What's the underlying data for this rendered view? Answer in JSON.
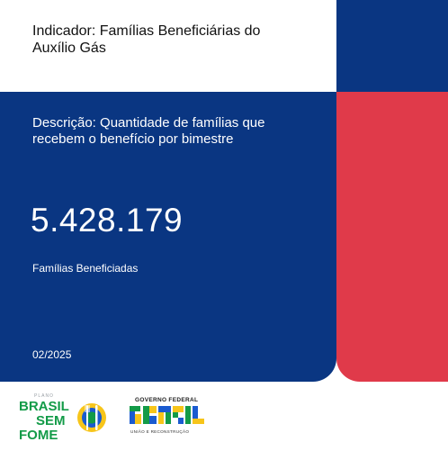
{
  "header": {
    "title": "Indicador: Famílias Beneficiárias do Auxílio Gás"
  },
  "card": {
    "description": "Descrição: Quantidade de famílias que recebem o benefício por bimestre",
    "value": "5.428.179",
    "value_label": "Famílias Beneficiadas",
    "period": "02/2025"
  },
  "logos": {
    "bsf_line1": "BRASIL",
    "bsf_line2": "SEM",
    "bsf_line3": "FOME",
    "bsf_small": "PLANO",
    "gov_line1": "GOVERNO FEDERAL",
    "gov_line2": "BRASIL",
    "gov_line3": "UNIÃO E RECONSTRUÇÃO"
  },
  "colors": {
    "navy": "#0a3682",
    "red": "#e03a4a",
    "green": "#139b48",
    "yellow": "#f7c51a",
    "blue": "#1a5bd0"
  }
}
